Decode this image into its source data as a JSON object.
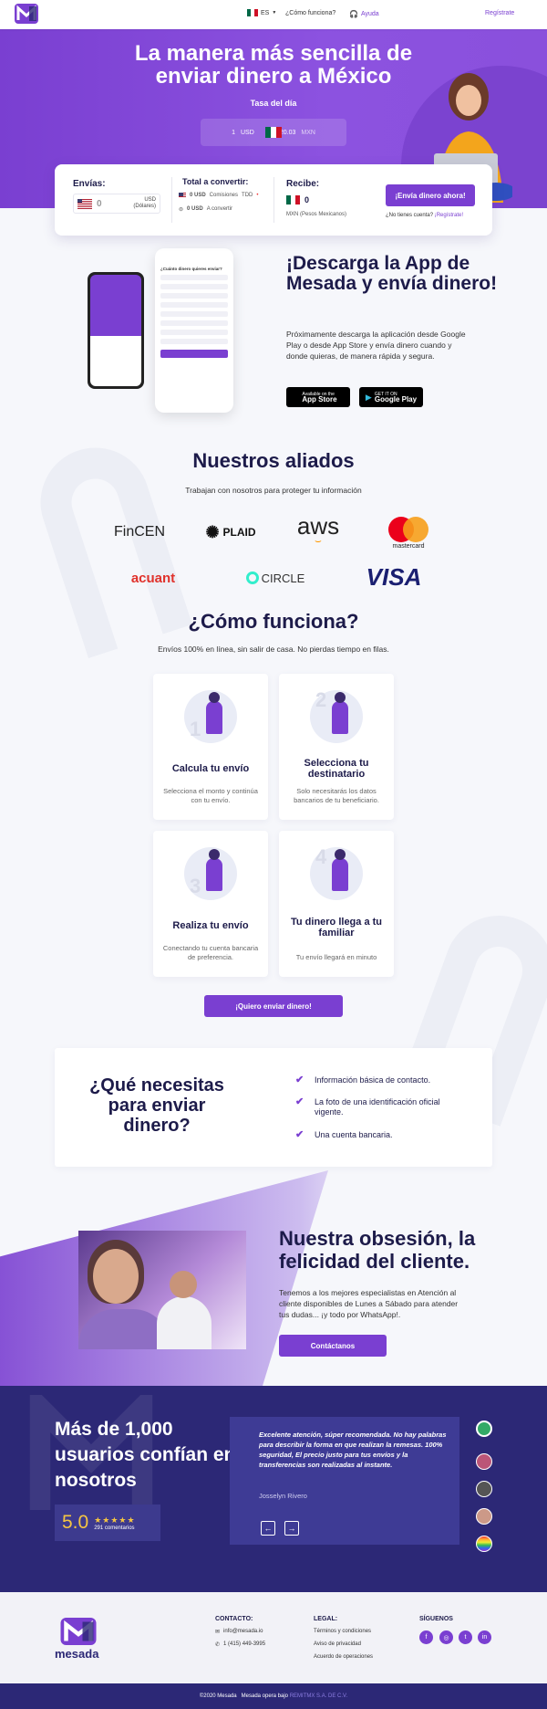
{
  "header": {
    "lang": "ES",
    "how": "¿Cómo funciona?",
    "help": "Ayuda",
    "register": "Regístrate"
  },
  "hero": {
    "title": "La manera más sencilla de enviar dinero a México",
    "rate_title": "Tasa del día",
    "rate_usd": "1",
    "rate_usd_cur": "USD",
    "rate_eq": "=",
    "rate_mxn": "20.03",
    "rate_mxn_cur": "MXN"
  },
  "converter": {
    "send_label": "Envías:",
    "send_value": "0",
    "send_cur": "USD",
    "send_cur_name": "(Dólares)",
    "total_label": "Total a convertir:",
    "total_usd": "0 USD",
    "fees_label": "Comisiones",
    "tbd": "TDD",
    "total_usd2": "0 USD",
    "to_convert": "A convertir",
    "receive_label": "Recibe:",
    "receive_value": "0",
    "receive_cur": "MXN (Pesos Mexicanos)",
    "button": "¡Envía dinero ahora!",
    "no_account": "¿No tienes cuenta?",
    "register_link": "¡Regístrate!"
  },
  "app": {
    "title": "¡Descarga la App de Mesada y envía dinero!",
    "text": "Próximamente descarga la aplicación desde Google Play o desde App Store y envía dinero cuando y donde quieras, de manera rápida y segura.",
    "appstore_small": "Available on the",
    "appstore": "App Store",
    "googleplay_small": "GET IT ON",
    "googleplay": "Google Play",
    "mock_title": "¿Cuánto dinero quieres enviar?"
  },
  "partners": {
    "title": "Nuestros aliados",
    "subtitle": "Trabajan con nosotros para proteger tu información",
    "items": [
      "FinCEN",
      "PLAID",
      "aws",
      "mastercard",
      "acuant",
      "CIRCLE",
      "VISA"
    ]
  },
  "how": {
    "title": "¿Cómo funciona?",
    "subtitle": "Envíos 100% en línea, sin salir de casa. No pierdas tiempo en filas.",
    "steps": [
      {
        "num": "1",
        "title": "Calcula tu envío",
        "text": "Selecciona el monto y continúa con tu envío."
      },
      {
        "num": "2",
        "title": "Selecciona tu destinatario",
        "text": "Solo necesitarás los datos bancarios de tu beneficiario."
      },
      {
        "num": "3",
        "title": "Realiza tu envío",
        "text": "Conectando tu cuenta bancaria de preferencia."
      },
      {
        "num": "4",
        "title": "Tu dinero llega a tu familiar",
        "text": "Tu envío llegará en minuto"
      }
    ],
    "button": "¡Quiero enviar dinero!"
  },
  "need": {
    "title": "¿Qué necesitas para enviar dinero?",
    "items": [
      "Información básica de contacto.",
      "La foto de una identificación oficial vigente.",
      "Una cuenta bancaria."
    ]
  },
  "obsession": {
    "title": "Nuestra obsesión, la felicidad del cliente.",
    "text": "Tenemos a los mejores especialistas en Atención al cliente disponibles de Lunes a Sábado para atender tus dudas... ¡y todo por WhatsApp!.",
    "button": "Contáctanos"
  },
  "testimonials": {
    "title": "Más de 1,000 usuarios confían en nosotros",
    "score": "5.0",
    "stars": "★★★★★",
    "count": "291 comentarios",
    "quote": "Excelente atención, súper recomendada. No hay palabras para describir la forma en que realizan la remesas. 100% seguridad, El precio justo para tus envíos y la transferencias son realizadas al instante.",
    "author": "Josselyn Rivero"
  },
  "footer": {
    "brand": "mesada",
    "contact_h": "CONTACTO:",
    "email": "info@mesada.io",
    "phone": "1 (415) 449-3995",
    "legal_h": "LEGAL:",
    "terms": "Términos y condiciones",
    "privacy": "Aviso de privacidad",
    "ops": "Acuerdo de operaciones",
    "social_h": "SÍGUENOS",
    "copyright": "©2020 Mesada",
    "operates": "Mesada opera bajo",
    "company": "REMITMX S.A. DE C.V."
  },
  "colors": {
    "primary": "#7a3fd1",
    "dark": "#2c2876",
    "text": "#1d1b4a"
  }
}
